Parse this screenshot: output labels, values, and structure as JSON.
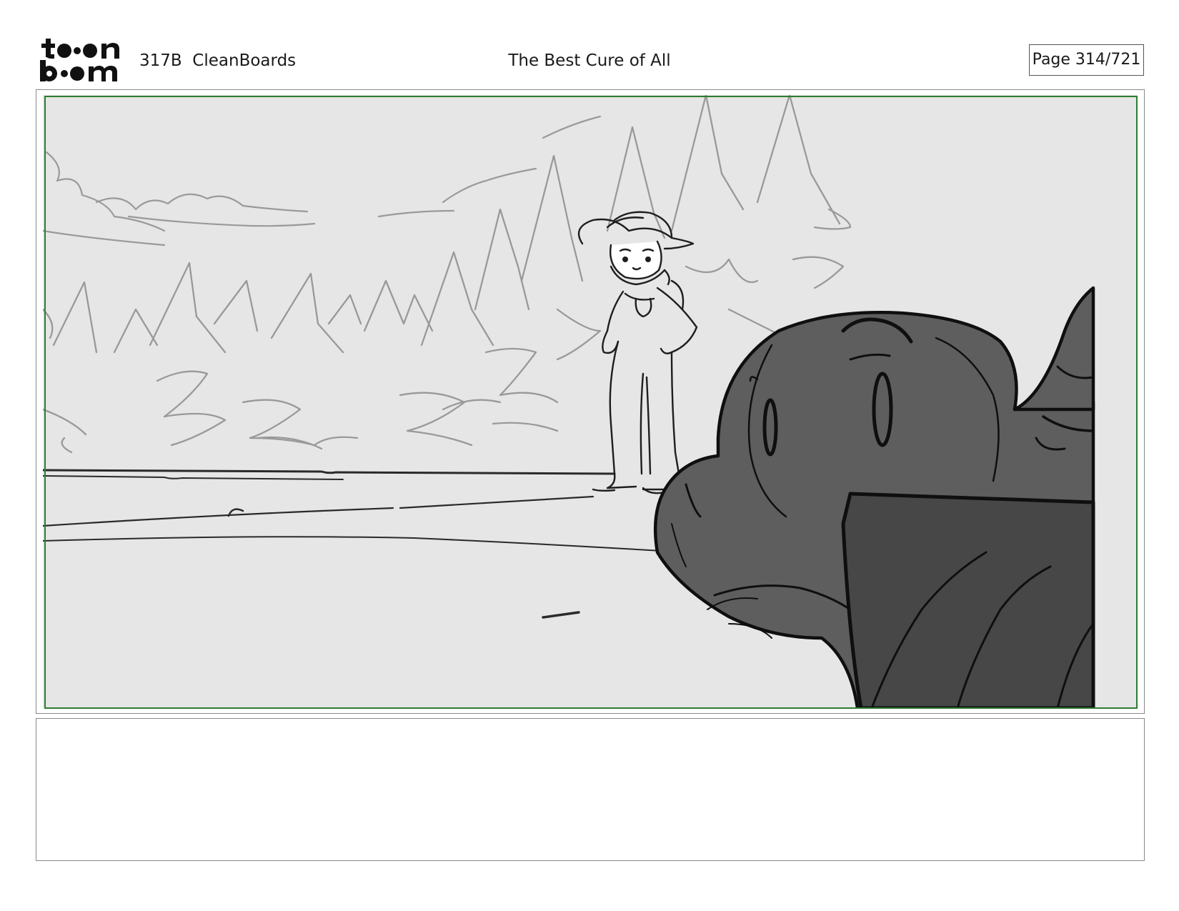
{
  "header": {
    "logo": {
      "icon": "toonboom-logo-icon",
      "alt": "toon boom"
    },
    "scene_id": "317B  CleanBoards",
    "title": "The Best Cure of All",
    "page_label": "Page 314/721"
  },
  "panel": {
    "icon": "storyboard-panel-drawing",
    "safe_area_color": "#2e7d32",
    "background_color": "#e6e6e6",
    "shadow_color": "#5e5e5e"
  },
  "notes": {
    "text": ""
  }
}
